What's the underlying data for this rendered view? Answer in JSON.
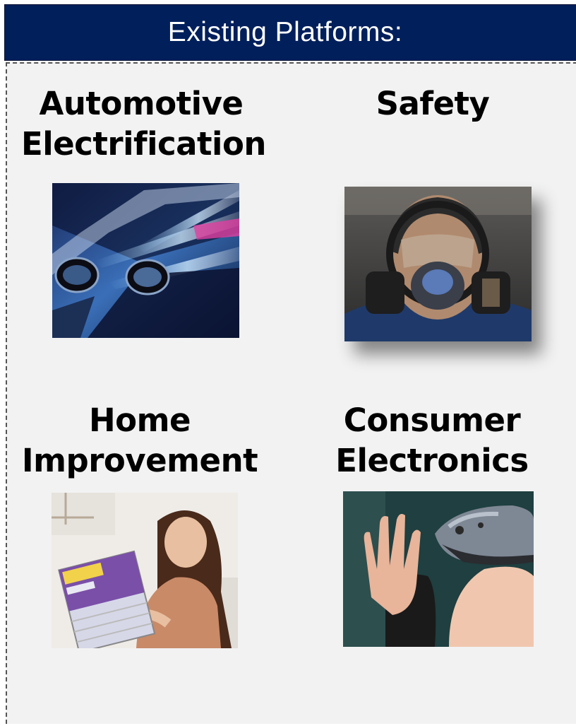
{
  "header": {
    "title": "Existing Platforms:"
  },
  "platforms": [
    {
      "line1": "Automotive",
      "line2": "Electrification",
      "image": "car-side-mirror-motion-photo"
    },
    {
      "line1": "Safety",
      "line2": "",
      "image": "full-face-respirator-mask-photo"
    },
    {
      "line1": "Home",
      "line2": "Improvement",
      "image": "woman-holding-air-filter-photo"
    },
    {
      "line1": "Consumer",
      "line2": "Electronics",
      "image": "person-wearing-vr-headset-photo"
    }
  ],
  "colors": {
    "header_bg": "#001f5b",
    "header_text": "#ffffff",
    "panel_bg": "#f2f2f2"
  }
}
